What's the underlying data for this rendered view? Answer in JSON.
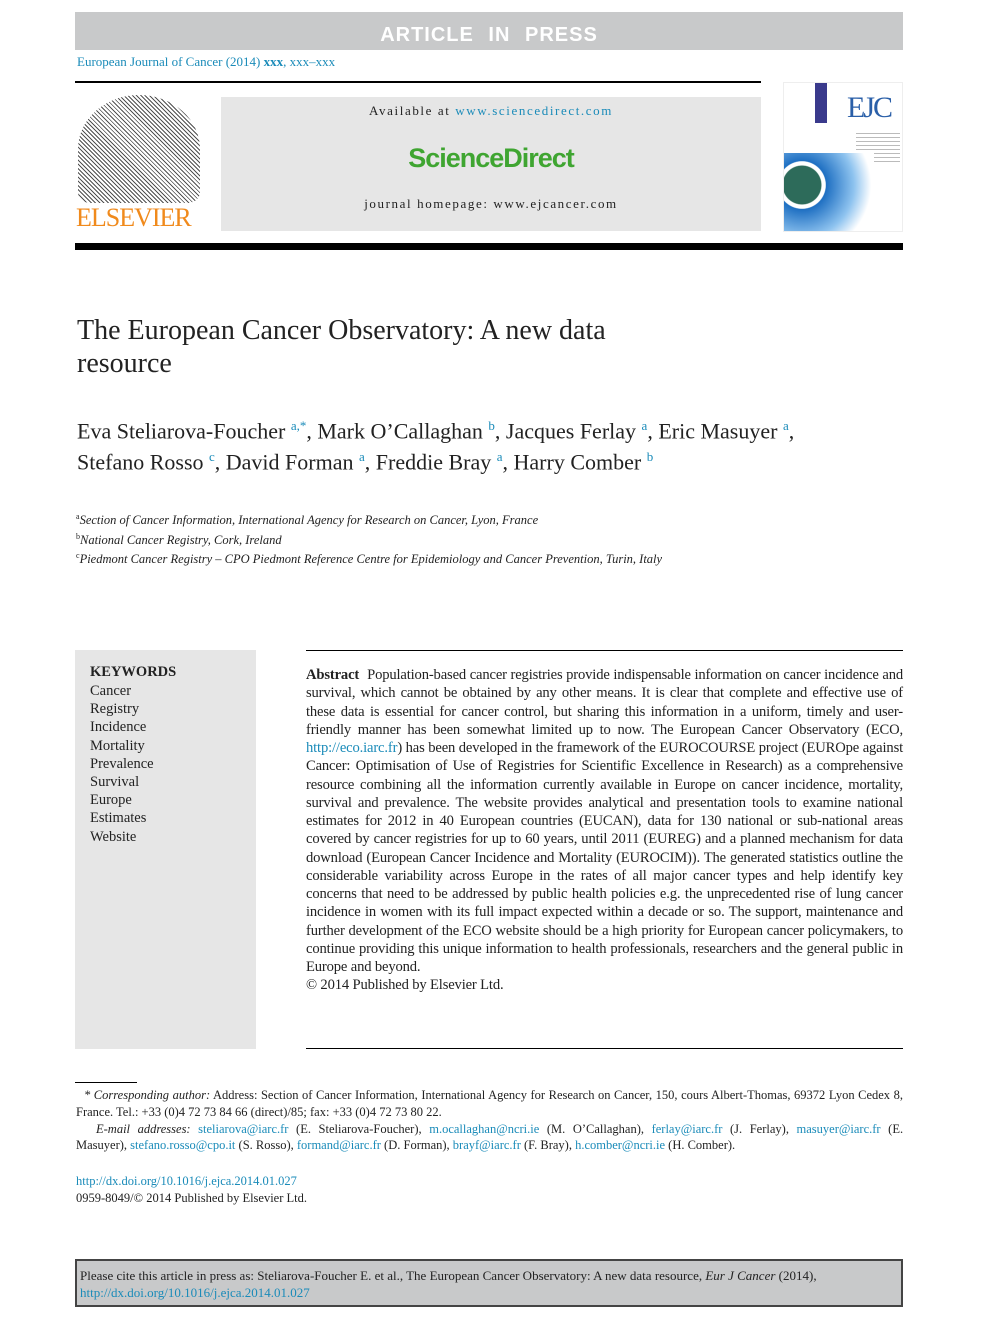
{
  "banner": "ARTICLE IN PRESS",
  "journal_ref": {
    "journal": "European Journal of Cancer (2014)",
    "volume": "xxx",
    "pages": ", xxx–xxx"
  },
  "publisher_logo": "ELSEVIER",
  "sciencedirect": {
    "available_label": "Available at",
    "available_url": "www.sciencedirect.com",
    "logo": "ScienceDirect",
    "homepage_label": "journal homepage:",
    "homepage_url": "www.ejcancer.com"
  },
  "cover": {
    "logo": "EJC"
  },
  "title": "The European Cancer Observatory: A new data resource",
  "authors": [
    {
      "name": "Eva Steliarova-Foucher",
      "aff": "a,*"
    },
    {
      "name": "Mark O’Callaghan",
      "aff": "b"
    },
    {
      "name": "Jacques Ferlay",
      "aff": "a"
    },
    {
      "name": "Eric Masuyer",
      "aff": "a"
    },
    {
      "name": "Stefano Rosso",
      "aff": "c"
    },
    {
      "name": "David Forman",
      "aff": "a"
    },
    {
      "name": "Freddie Bray",
      "aff": "a"
    },
    {
      "name": "Harry Comber",
      "aff": "b"
    }
  ],
  "affiliations": [
    {
      "mark": "a",
      "text": "Section of Cancer Information, International Agency for Research on Cancer, Lyon, France"
    },
    {
      "mark": "b",
      "text": "National Cancer Registry, Cork, Ireland"
    },
    {
      "mark": "c",
      "text": "Piedmont Cancer Registry – CPO Piedmont Reference Centre for Epidemiology and Cancer Prevention, Turin, Italy"
    }
  ],
  "keywords": {
    "heading": "KEYWORDS",
    "items": [
      "Cancer",
      "Registry",
      "Incidence",
      "Mortality",
      "Prevalence",
      "Survival",
      "Europe",
      "Estimates",
      "Website"
    ]
  },
  "abstract": {
    "label": "Abstract",
    "text_1": "Population-based cancer registries provide indispensable information on cancer incidence and survival, which cannot be obtained by any other means. It is clear that complete and effective use of these data is essential for cancer control, but sharing this information in a uniform, timely and user-friendly manner has been somewhat limited up to now. The European Cancer Observatory (ECO,",
    "link": "http://eco.iarc.fr",
    "text_2": ") has been developed in the framework of the EUROCOURSE project (EUROpe against Cancer: Optimisation of Use of Registries for Scientific Excellence in Research) as a comprehensive resource combining all the information currently available in Europe on cancer incidence, mortality, survival and prevalence. The website provides analytical and presentation tools to examine national estimates for 2012 in 40 European countries (EUCAN), data for 130 national or sub-national areas covered by cancer registries for up to 60 years, until 2011 (EUREG) and a planned mechanism for data download (European Cancer Incidence and Mortality (EUROCIM)). The generated statistics outline the considerable variability across Europe in the rates of all major cancer types and help identify key concerns that need to be addressed by public health policies e.g. the unprecedented rise of lung cancer incidence in women with its full impact expected within a decade or so. The support, maintenance and further development of the ECO website should be a high priority for European cancer policymakers, to continue providing this unique information to health professionals, researchers and the general public in Europe and beyond.",
    "copyright": "© 2014 Published by Elsevier Ltd."
  },
  "footnotes": {
    "corr_label": "* Corresponding author:",
    "corr_text": "Address: Section of Cancer Information, International Agency for Research on Cancer, 150, cours Albert-Thomas, 69372 Lyon Cedex 8, France. Tel.: +33 (0)4 72 73 84 66 (direct)/85; fax: +33 (0)4 72 73 80 22.",
    "email_label": "E-mail addresses:",
    "emails": [
      {
        "email": "steliarova@iarc.fr",
        "who": "(E. Steliarova-Foucher),"
      },
      {
        "email": "m.ocallaghan@ncri.ie",
        "who": "(M. O’Callaghan),"
      },
      {
        "email": "ferlay@iarc.fr",
        "who": "(J. Ferlay),"
      },
      {
        "email": "masuyer@iarc.fr",
        "who": "(E. Masuyer),"
      },
      {
        "email": "stefano.rosso@cpo.it",
        "who": "(S. Rosso),"
      },
      {
        "email": "formand@iarc.fr",
        "who": "(D. Forman),"
      },
      {
        "email": "brayf@iarc.fr",
        "who": "(F. Bray),"
      },
      {
        "email": "h.comber@ncri.ie",
        "who": "(H. Comber)."
      }
    ]
  },
  "doi": "http://dx.doi.org/10.1016/j.ejca.2014.01.027",
  "issn_line": "0959-8049/© 2014 Published by Elsevier Ltd.",
  "cite": {
    "prefix": "Please cite this article in press as: Steliarova-Foucher E. et al., The European Cancer Observatory: A new data resource,",
    "journal": "Eur J Cancer",
    "year": "(2014),",
    "doi": "http://dx.doi.org/10.1016/j.ejca.2014.01.027"
  }
}
